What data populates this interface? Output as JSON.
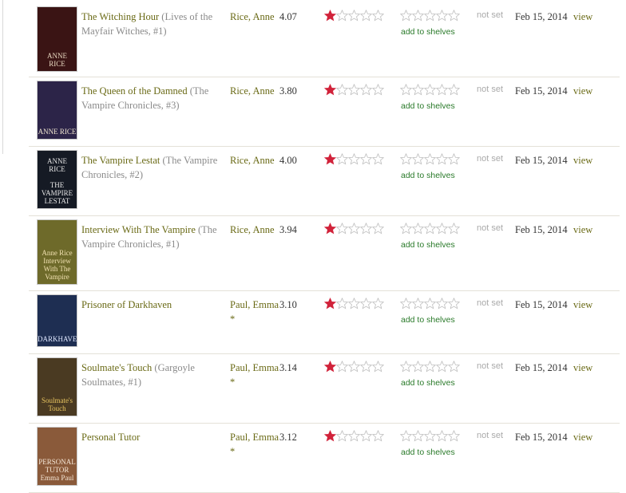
{
  "colors": {
    "link": "#6a6a16",
    "star_filled": "#d1223a",
    "star_empty": "#d8d8d8",
    "add_shelves": "#2a7a2a",
    "not_set": "#aaaaaa"
  },
  "labels": {
    "add_to_shelves": "add to shelves",
    "not_set": "not set",
    "view": "view"
  },
  "books": [
    {
      "title": "The Witching Hour",
      "series": "(Lives of the Mayfair Witches, #1)",
      "author": "Rice, Anne",
      "avg_rating": "4.07",
      "avg_stars": 1,
      "date_added": "Feb 15, 2014",
      "cover": {
        "lines": [
          "ANNE",
          "RICE"
        ],
        "bg": "#3a1414",
        "fg": "#e8d9c0"
      }
    },
    {
      "title": "The Queen of the Damned",
      "series": "(The Vampire Chronicles, #3)",
      "author": "Rice, Anne",
      "avg_rating": "3.80",
      "avg_stars": 1,
      "date_added": "Feb 15, 2014",
      "cover": {
        "lines": [
          "ANNE RICE"
        ],
        "bg": "#2c2448",
        "fg": "#f0e6d0"
      }
    },
    {
      "title": "The Vampire Lestat",
      "series": "(The Vampire Chronicles, #2)",
      "author": "Rice, Anne",
      "avg_rating": "4.00",
      "avg_stars": 1,
      "date_added": "Feb 15, 2014",
      "cover": {
        "lines": [
          "ANNE",
          "RICE",
          "",
          "THE",
          "VAMPIRE",
          "LESTAT"
        ],
        "bg": "#151a24",
        "fg": "#e6e6e6"
      }
    },
    {
      "title": "Interview With The Vampire",
      "series": "(The Vampire Chronicles, #1)",
      "author": "Rice, Anne",
      "avg_rating": "3.94",
      "avg_stars": 1,
      "date_added": "Feb 15, 2014",
      "cover": {
        "lines": [
          "Anne Rice",
          "Interview",
          "With The",
          "Vampire"
        ],
        "bg": "#6e6a2a",
        "fg": "#f0e0b0"
      }
    },
    {
      "title": "Prisoner of Darkhaven",
      "series": "",
      "author": "Paul, Emma *",
      "avg_rating": "3.10",
      "avg_stars": 1,
      "date_added": "Feb 15, 2014",
      "cover": {
        "lines": [
          "DARKHAVEN"
        ],
        "bg": "#1e2e52",
        "fg": "#e0e8ff"
      }
    },
    {
      "title": "Soulmate's Touch",
      "series": "(Gargoyle Soulmates, #1)",
      "author": "Paul, Emma *",
      "avg_rating": "3.14",
      "avg_stars": 1,
      "date_added": "Feb 15, 2014",
      "cover": {
        "lines": [
          "Soulmate's",
          "Touch"
        ],
        "bg": "#4a3a22",
        "fg": "#e8c460"
      }
    },
    {
      "title": "Personal Tutor",
      "series": "",
      "author": "Paul, Emma *",
      "avg_rating": "3.12",
      "avg_stars": 1,
      "date_added": "Feb 15, 2014",
      "cover": {
        "lines": [
          "PERSONAL",
          "TUTOR",
          "Emma Paul"
        ],
        "bg": "#8a5a3a",
        "fg": "#f4e6d6"
      }
    }
  ]
}
